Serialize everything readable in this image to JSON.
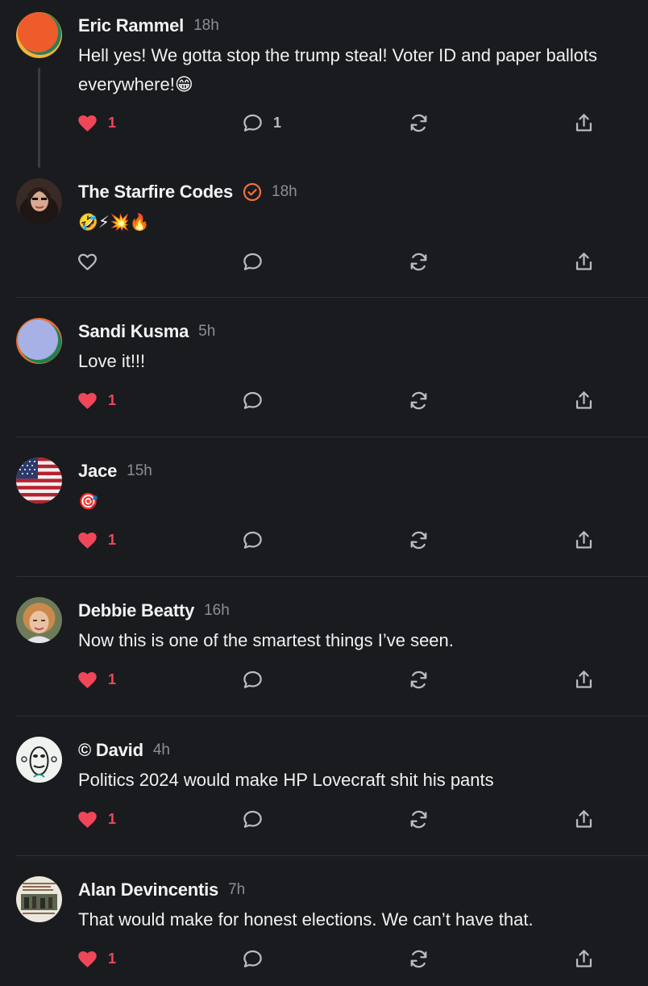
{
  "posts": [
    {
      "name": "Eric Rammel",
      "time": "18h",
      "text": "Hell yes! We gotta stop the trump steal! Voter ID and paper ballots everywhere!😁",
      "likes": "1",
      "liked": true,
      "replies": "1",
      "avatar": "orange-green-circle-avatar"
    },
    {
      "name": "The Starfire Codes",
      "time": "18h",
      "verified": true,
      "text": "🤣⚡💥🔥",
      "likes": "",
      "liked": false,
      "replies": "",
      "avatar": "woman-photo-avatar"
    },
    {
      "name": "Sandi Kusma",
      "time": "5h",
      "text": "Love it!!!",
      "likes": "1",
      "liked": true,
      "replies": "",
      "avatar": "lavender-circle-avatar"
    },
    {
      "name": "Jace",
      "time": "15h",
      "text": "🎯",
      "likes": "1",
      "liked": true,
      "replies": "",
      "avatar": "us-flag-avatar"
    },
    {
      "name": "Debbie Beatty",
      "time": "16h",
      "text": "Now this is one of the smartest things I’ve seen.",
      "likes": "1",
      "liked": true,
      "replies": "",
      "avatar": "woman-portrait-avatar"
    },
    {
      "name": "© David",
      "time": "4h",
      "text": "Politics 2024 would make HP Lovecraft shit his pants",
      "likes": "1",
      "liked": true,
      "replies": "",
      "avatar": "mask-drawing-avatar"
    },
    {
      "name": "Alan Devincentis",
      "time": "7h",
      "text": "That would make for honest elections. We can’t have that.",
      "likes": "1",
      "liked": true,
      "replies": "",
      "avatar": "meme-image-avatar"
    }
  ],
  "colors": {
    "background": "#1a1b1e",
    "like_active": "#f0465a",
    "verified": "#f2703a",
    "muted_text": "#8c8e94"
  },
  "icons": [
    "heart-icon",
    "reply-icon",
    "repost-icon",
    "share-icon",
    "verified-icon"
  ]
}
